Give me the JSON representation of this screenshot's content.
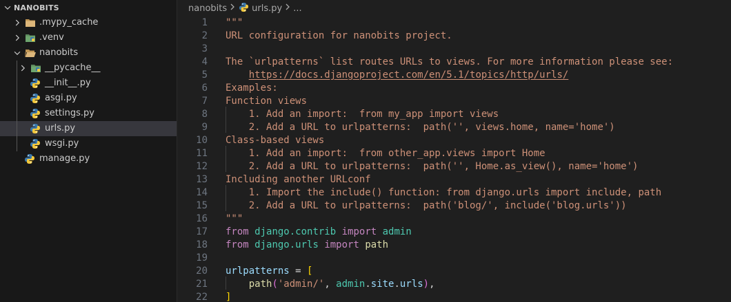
{
  "explorer": {
    "section_title": "NANOBITS",
    "items": [
      {
        "label": ".mypy_cache",
        "kind": "folder",
        "expanded": false
      },
      {
        "label": ".venv",
        "kind": "python-folder",
        "expanded": false
      },
      {
        "label": "nanobits",
        "kind": "folder-open",
        "expanded": true
      },
      {
        "label": "__pycache__",
        "kind": "python-folder",
        "expanded": false
      },
      {
        "label": "__init__.py",
        "kind": "python-file"
      },
      {
        "label": "asgi.py",
        "kind": "python-file"
      },
      {
        "label": "settings.py",
        "kind": "python-file"
      },
      {
        "label": "urls.py",
        "kind": "python-file",
        "selected": true
      },
      {
        "label": "wsgi.py",
        "kind": "python-file"
      },
      {
        "label": "manage.py",
        "kind": "python-file"
      }
    ]
  },
  "breadcrumb": {
    "folder": "nanobits",
    "file": "urls.py",
    "more": "..."
  },
  "colors": {
    "docstring": "#ce9178",
    "keyword": "#c586c0",
    "module": "#4ec9b0",
    "variable": "#9cdcfe",
    "function": "#dcdcaa",
    "bracket": "#ffd700",
    "selection": "#37373d"
  },
  "editor": {
    "lines": [
      {
        "n": "1",
        "tokens": [
          [
            "t-doc",
            "\"\"\""
          ]
        ]
      },
      {
        "n": "2",
        "tokens": [
          [
            "t-doc",
            "URL configuration for nanobits project."
          ]
        ]
      },
      {
        "n": "3",
        "tokens": []
      },
      {
        "n": "4",
        "tokens": [
          [
            "t-doc",
            "The `urlpatterns` list routes URLs to views. For more information please see:"
          ]
        ]
      },
      {
        "n": "5",
        "tokens": [
          [
            "t-doc",
            "    "
          ],
          [
            "t-link",
            "https://docs.djangoproject.com/en/5.1/topics/http/urls/"
          ]
        ]
      },
      {
        "n": "6",
        "tokens": [
          [
            "t-doc",
            "Examples:"
          ]
        ]
      },
      {
        "n": "7",
        "tokens": [
          [
            "t-doc",
            "Function views"
          ]
        ]
      },
      {
        "n": "8",
        "tokens": [
          [
            "t-doc",
            "    1. Add an import:  from my_app import views"
          ]
        ]
      },
      {
        "n": "9",
        "tokens": [
          [
            "t-doc",
            "    2. Add a URL to urlpatterns:  path('', views.home, name='home')"
          ]
        ]
      },
      {
        "n": "10",
        "tokens": [
          [
            "t-doc",
            "Class-based views"
          ]
        ]
      },
      {
        "n": "11",
        "tokens": [
          [
            "t-doc",
            "    1. Add an import:  from other_app.views import Home"
          ]
        ]
      },
      {
        "n": "12",
        "tokens": [
          [
            "t-doc",
            "    2. Add a URL to urlpatterns:  path('', Home.as_view(), name='home')"
          ]
        ]
      },
      {
        "n": "13",
        "tokens": [
          [
            "t-doc",
            "Including another URLconf"
          ]
        ]
      },
      {
        "n": "14",
        "tokens": [
          [
            "t-doc",
            "    1. Import the include() function: from django.urls import include, path"
          ]
        ]
      },
      {
        "n": "15",
        "tokens": [
          [
            "t-doc",
            "    2. Add a URL to urlpatterns:  path('blog/', include('blog.urls'))"
          ]
        ]
      },
      {
        "n": "16",
        "tokens": [
          [
            "t-doc",
            "\"\"\""
          ]
        ]
      },
      {
        "n": "17",
        "tokens": [
          [
            "t-kw",
            "from"
          ],
          [
            "t-plain",
            " "
          ],
          [
            "t-mod",
            "django.contrib"
          ],
          [
            "t-plain",
            " "
          ],
          [
            "t-kw",
            "import"
          ],
          [
            "t-plain",
            " "
          ],
          [
            "t-mod",
            "admin"
          ]
        ]
      },
      {
        "n": "18",
        "tokens": [
          [
            "t-kw",
            "from"
          ],
          [
            "t-plain",
            " "
          ],
          [
            "t-mod",
            "django.urls"
          ],
          [
            "t-plain",
            " "
          ],
          [
            "t-kw",
            "import"
          ],
          [
            "t-plain",
            " "
          ],
          [
            "t-fn",
            "path"
          ]
        ]
      },
      {
        "n": "19",
        "tokens": []
      },
      {
        "n": "20",
        "tokens": [
          [
            "t-var",
            "urlpatterns"
          ],
          [
            "t-op",
            " = "
          ],
          [
            "t-br",
            "["
          ]
        ]
      },
      {
        "n": "21",
        "tokens": [
          [
            "t-plain",
            "    "
          ],
          [
            "t-fn",
            "path"
          ],
          [
            "t-br2",
            "("
          ],
          [
            "t-str",
            "'admin/'"
          ],
          [
            "t-plain",
            ", "
          ],
          [
            "t-mod",
            "admin"
          ],
          [
            "t-plain",
            "."
          ],
          [
            "t-var",
            "site"
          ],
          [
            "t-plain",
            "."
          ],
          [
            "t-var",
            "urls"
          ],
          [
            "t-br2",
            ")"
          ],
          [
            "t-plain",
            ","
          ]
        ]
      },
      {
        "n": "22",
        "tokens": [
          [
            "t-br",
            "]"
          ]
        ]
      }
    ]
  }
}
